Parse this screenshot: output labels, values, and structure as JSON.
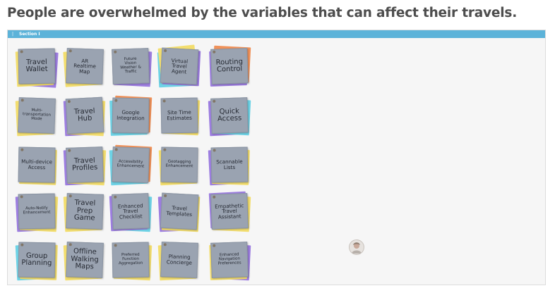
{
  "headline": "People are overwhelmed by the variables that can affect their travels.",
  "section": {
    "title": "Section I"
  },
  "colors": {
    "note_gray": "#9aa3b1",
    "section_bar": "#5cb3d9",
    "yellow": "#f3de6f",
    "purple": "#9d7ee0",
    "cyan": "#6ed3e6",
    "orange": "#f0925a"
  },
  "notes": [
    {
      "label": "Travel\nWallet"
    },
    {
      "label": "AR\nRealtime\nMap"
    },
    {
      "label": "Future\nVision\nWeather &\nTraffic"
    },
    {
      "label": "Virtual\nTravel\nAgent"
    },
    {
      "label": "Routing\nControl"
    },
    {
      "label": "Multi-\ntransportation\nMode"
    },
    {
      "label": "Travel\nHub"
    },
    {
      "label": "Google\nIntegration"
    },
    {
      "label": "Site Time\nEstimates"
    },
    {
      "label": "Quick\nAccess"
    },
    {
      "label": "Multi-device\nAccess"
    },
    {
      "label": "Travel\nProfiles"
    },
    {
      "label": "Accessibility\nEnhancement"
    },
    {
      "label": "Geotagging\nEnhancement"
    },
    {
      "label": "Scannable\nLists"
    },
    {
      "label": "Auto-Notify\nEnhancement"
    },
    {
      "label": "Travel\nPrep\nGame"
    },
    {
      "label": "Enhanced\nTravel\nChecklist"
    },
    {
      "label": "Travel\nTemplates"
    },
    {
      "label": "Empathetic\nTravel\nAssistant"
    },
    {
      "label": "Group\nPlanning"
    },
    {
      "label": "Offline\nWalking\nMaps"
    },
    {
      "label": "Preferred\nFunction\nAggregation"
    },
    {
      "label": "Planning\nConcierge"
    },
    {
      "label": "Enhanced\nNavigation\nPreferences"
    }
  ],
  "avatar": {
    "icon": "user-avatar"
  }
}
